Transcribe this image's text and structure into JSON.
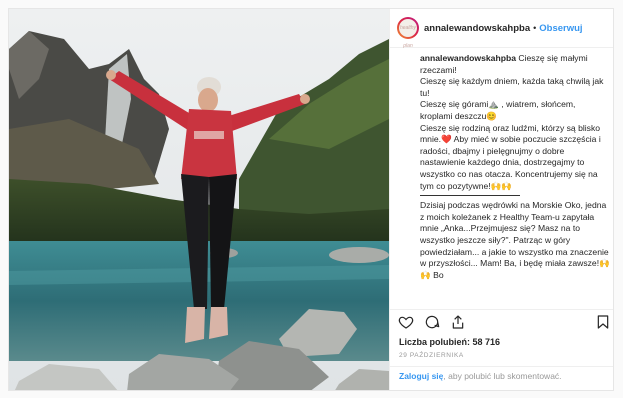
{
  "header": {
    "username": "annalewandowskahpba",
    "separator": "•",
    "follow_label": "Obserwuj",
    "avatar_text": "healthy plan"
  },
  "caption": {
    "username": "annalewandowskahpba",
    "p1": "Cieszę się małymi rzeczami!",
    "p2": "Cieszę się każdym dniem, każda taką chwilą jak tu!",
    "p3": "Cieszę się górami⛰️ , wiatrem, słońcem, kroplami deszczu😊",
    "p4": "Cieszę się rodziną oraz ludźmi, którzy są blisko mnie.❤️ Aby mieć w sobie poczucie szczęścia i radości, dbajmy i pielęgnujmy o dobre nastawienie każdego dnia, dostrzegajmy to wszystko co nas otacza. Koncentrujemy się na tym co pozytywne!🙌🙌",
    "p5": "Dzisiaj podczas wędrówki na Morskie Oko, jedna z moich koleżanek z Healthy Team-u zapytała mnie „Anka...Przejmujesz się? Masz na to wszystko jeszcze siły?\". Patrząc w góry powiedziałam... a jakie to wszystko ma znaczenie w przyszłości... Mam! Ba, i będę miała zawsze!🙌🙌 Bo"
  },
  "actions": {
    "like_icon": "heart-icon",
    "comment_icon": "comment-icon",
    "share_icon": "share-icon",
    "save_icon": "bookmark-icon"
  },
  "likes": {
    "text": "Liczba polubień: 58 716"
  },
  "date": "29 PAŹDZIERNIKA",
  "login": {
    "link": "Zaloguj się",
    "rest": ", aby polubić lub skomentować."
  }
}
